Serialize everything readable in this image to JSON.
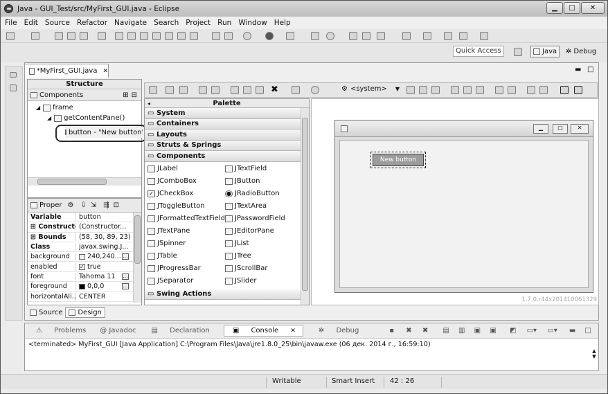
{
  "window": {
    "title": "Java - GUI_Test/src/MyFirst_GUI.java - Eclipse"
  },
  "menu": [
    "File",
    "Edit",
    "Source",
    "Refactor",
    "Navigate",
    "Search",
    "Project",
    "Run",
    "Window",
    "Help"
  ],
  "toolbar": {
    "quick_access": "Quick Access",
    "persp_java": "Java",
    "persp_debug": "Debug",
    "system_combo": "<system>"
  },
  "editor": {
    "tab": "*MyFirst_GUI.java"
  },
  "structure": {
    "title": "Structure",
    "components_label": "Components",
    "tree": [
      "frame",
      "getContentPane()",
      "button - \"New button\""
    ]
  },
  "properties": {
    "title": "Proper",
    "rows": [
      {
        "k": "Variable",
        "v": "button"
      },
      {
        "k": "Constructor",
        "v": "(Constructor..."
      },
      {
        "k": "Bounds",
        "v": "(58, 30, 89, 23)"
      },
      {
        "k": "Class",
        "v": "javax.swing.J..."
      },
      {
        "k": "background",
        "v": "240,240..."
      },
      {
        "k": "enabled",
        "v": "true"
      },
      {
        "k": "font",
        "v": "Tahoma 11"
      },
      {
        "k": "foreground",
        "v": "0,0,0"
      },
      {
        "k": "horizontalAli...",
        "v": "CENTER"
      }
    ]
  },
  "palette": {
    "title": "Palette",
    "categories": [
      "System",
      "Containers",
      "Layouts",
      "Struts & Springs",
      "Components",
      "Swing Actions"
    ],
    "items_left": [
      "JLabel",
      "JComboBox",
      "JCheckBox",
      "JToggleButton",
      "JFormattedTextField",
      "JTextPane",
      "JSpinner",
      "JTable",
      "JProgressBar",
      "JSeparator"
    ],
    "items_right": [
      "JTextField",
      "JButton",
      "JRadioButton",
      "JTextArea",
      "JPasswordField",
      "JEditorPane",
      "JList",
      "JTree",
      "JScrollBar",
      "JSlider"
    ]
  },
  "canvas": {
    "button_label": "New button",
    "version": "1.7.0.r44x201410061329"
  },
  "bottom_tabs": {
    "source": "Source",
    "design": "Design"
  },
  "console": {
    "tabs": [
      "Problems",
      "@ Javadoc",
      "Declaration",
      "Console",
      "Debug"
    ],
    "output": "<terminated> MyFirst_GUI [Java Application] C:\\Program Files\\Java\\jre1.8.0_25\\bin\\javaw.exe (06 дек. 2014 г., 16:59:10)"
  },
  "status": {
    "writable": "Writable",
    "insert": "Smart Insert",
    "position": "42 : 26"
  },
  "colors": {
    "accent": "#000000",
    "selected_button_bg": "#9c9c9c"
  }
}
